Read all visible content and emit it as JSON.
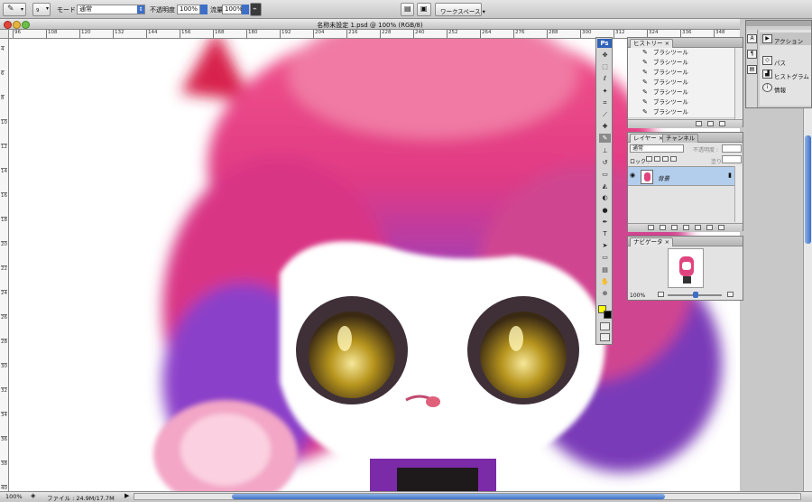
{
  "options_bar": {
    "brush_size": "9",
    "mode_label": "モード :",
    "mode_value": "通常",
    "opacity_label": "不透明度 :",
    "opacity_value": "100%",
    "flow_label": "流量 :",
    "flow_value": "100%",
    "workspace_label": "ワークスペース ▾"
  },
  "document": {
    "title": "名称未設定 1.psd @ 100% (RGB/8)",
    "ruler_top": [
      "96",
      "108",
      "120",
      "132",
      "144",
      "156",
      "168",
      "180",
      "192",
      "204",
      "216",
      "228",
      "240",
      "252",
      "264",
      "276",
      "288",
      "300",
      "312",
      "324",
      "336",
      "348"
    ],
    "ruler_left": [
      "4",
      "6",
      "8",
      "10",
      "12",
      "14",
      "16",
      "18",
      "20",
      "22",
      "24",
      "26",
      "28",
      "30",
      "32",
      "34",
      "36",
      "38",
      "40"
    ]
  },
  "status_bar": {
    "zoom": "100%",
    "file_info": "ファイル : 24.9M/17.7M"
  },
  "toolbox": {
    "logo": "Ps",
    "tools": [
      "move-icon",
      "marquee-icon",
      "lasso-icon",
      "magic-wand-icon",
      "crop-icon",
      "eyedropper-icon",
      "healing-icon",
      "brush-icon",
      "stamp-icon",
      "history-brush-icon",
      "eraser-icon",
      "bucket-icon",
      "blur-icon",
      "dodge-icon",
      "pen-icon",
      "type-icon",
      "path-select-icon",
      "shape-icon",
      "notes-icon",
      "hand-icon",
      "zoom-icon"
    ],
    "foreground_color": "#ffff00",
    "background_color": "#000000"
  },
  "history_panel": {
    "tab": "ヒストリー",
    "items": [
      "ブラシツール",
      "ブラシツール",
      "ブラシツール",
      "ブラシツール",
      "ブラシツール",
      "ブラシツール",
      "ブラシツール"
    ]
  },
  "layers_panel": {
    "tabs": [
      "レイヤー",
      "チャンネル"
    ],
    "blend_mode": "通常",
    "opacity_label": "不透明度 :",
    "lock_label": "ロック :",
    "fill_label": "塗り :",
    "layer_name": "背景"
  },
  "navigator_panel": {
    "tab": "ナビゲータ",
    "zoom": "100%"
  },
  "dock_right": {
    "items": [
      "アクション",
      "パス",
      "ヒストグラム",
      "情報"
    ]
  },
  "colors": {
    "accent": "#3d6fc8",
    "selected_layer": "#b3ceec"
  }
}
